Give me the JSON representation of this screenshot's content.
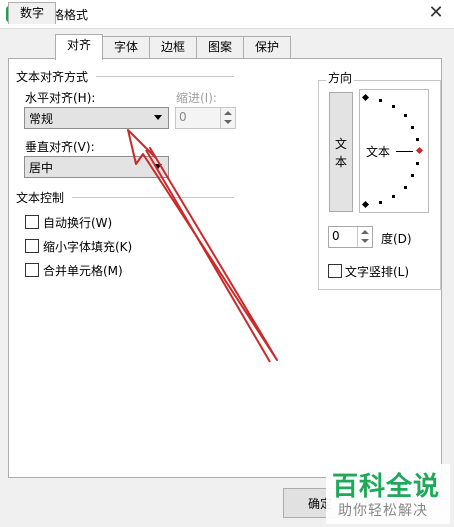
{
  "window": {
    "title": "单元格格式",
    "app_icon": "S",
    "close_glyph": "✕"
  },
  "tabs": [
    {
      "label": "数字"
    },
    {
      "label": "对齐"
    },
    {
      "label": "字体"
    },
    {
      "label": "边框"
    },
    {
      "label": "图案"
    },
    {
      "label": "保护"
    }
  ],
  "active_tab": "对齐",
  "text_alignment": {
    "group_title": "文本对齐方式",
    "horizontal_label": "水平对齐(H):",
    "horizontal_value": "常规",
    "indent_label": "缩进(I):",
    "indent_value": "0",
    "vertical_label": "垂直对齐(V):",
    "vertical_value": "居中"
  },
  "text_control": {
    "group_title": "文本控制",
    "options": [
      {
        "label": "自动换行(W)",
        "checked": false
      },
      {
        "label": "缩小字体填充(K)",
        "checked": false
      },
      {
        "label": "合并单元格(M)",
        "checked": false
      }
    ]
  },
  "orientation": {
    "group_title": "方向",
    "vertical_text": [
      "文",
      "本"
    ],
    "dial_text": "文本",
    "degree_value": "0",
    "degree_label": "度(D)",
    "vertical_layout_label": "文字竖排(L)",
    "vertical_layout_checked": false
  },
  "footer": {
    "ok_label": "确定"
  },
  "watermark": {
    "title": "百科全说",
    "subtitle": "助你轻松解决"
  },
  "colors": {
    "annotation_arrow": "#cc2a2a",
    "watermark_green": "#1fa85a",
    "app_icon": "#1aa34a"
  }
}
